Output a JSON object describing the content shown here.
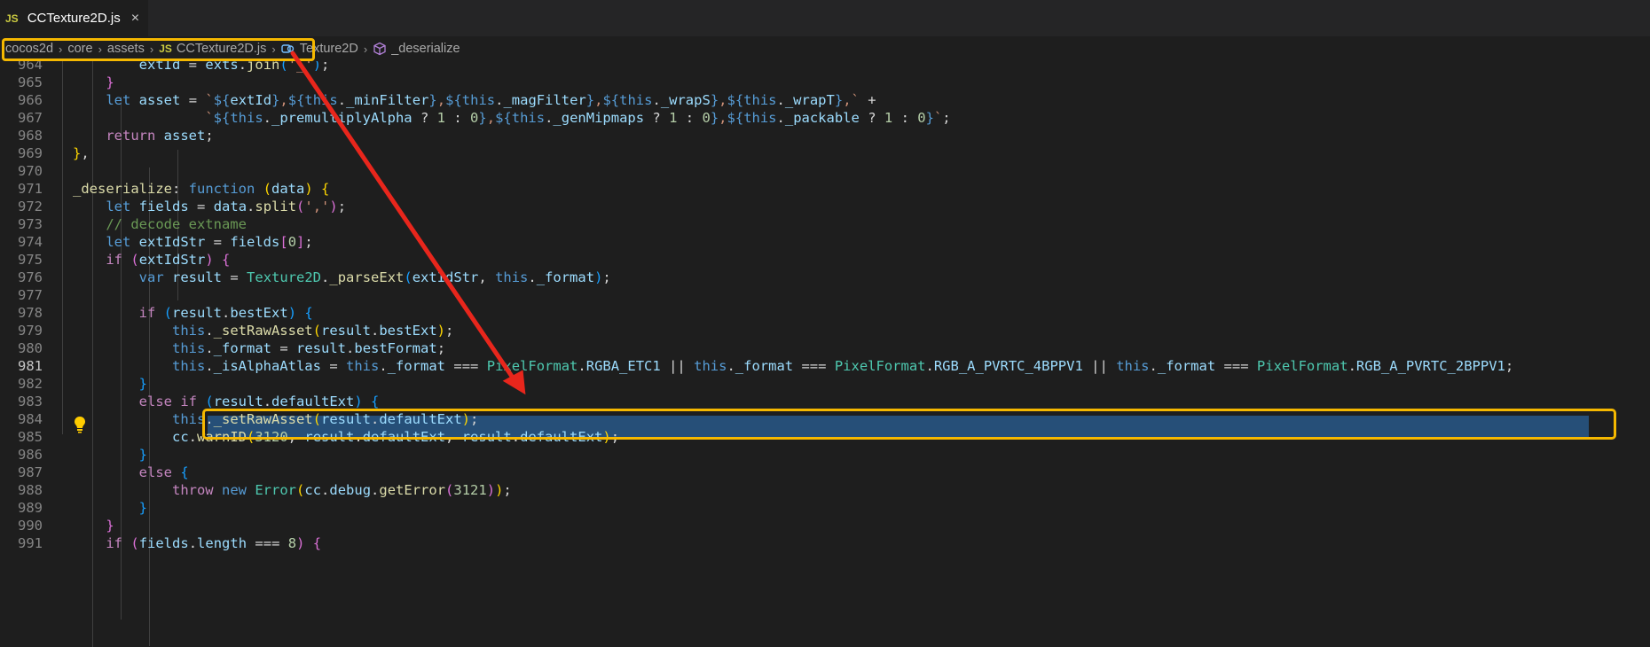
{
  "tab": {
    "badge": "JS",
    "filename": "CCTexture2D.js",
    "close": "×"
  },
  "breadcrumb": {
    "items": [
      "cocos2d",
      "core",
      "assets",
      "CCTexture2D.js",
      "Texture2D",
      "_deserialize"
    ],
    "file_badge": "JS",
    "separator": "›"
  },
  "editor": {
    "active_line": 981,
    "lines": [
      {
        "n": 964,
        "text": "            extId = exts.join('_');"
      },
      {
        "n": 965,
        "text": "        }"
      },
      {
        "n": 966,
        "text": "        let asset = `${extId},${this._minFilter},${this._magFilter},${this._wrapS},${this._wrapT},` +"
      },
      {
        "n": 967,
        "text": "                    `${this._premultiplyAlpha ? 1 : 0},${this._genMipmaps ? 1 : 0},${this._packable ? 1 : 0}`;"
      },
      {
        "n": 968,
        "text": "        return asset;"
      },
      {
        "n": 969,
        "text": "    },"
      },
      {
        "n": 970,
        "text": ""
      },
      {
        "n": 971,
        "text": "    _deserialize: function (data) {"
      },
      {
        "n": 972,
        "text": "        let fields = data.split(',');"
      },
      {
        "n": 973,
        "text": "        // decode extname"
      },
      {
        "n": 974,
        "text": "        let extIdStr = fields[0];"
      },
      {
        "n": 975,
        "text": "        if (extIdStr) {"
      },
      {
        "n": 976,
        "text": "            var result = Texture2D._parseExt(extIdStr, this._format);"
      },
      {
        "n": 977,
        "text": ""
      },
      {
        "n": 978,
        "text": "            if (result.bestExt) {"
      },
      {
        "n": 979,
        "text": "                this._setRawAsset(result.bestExt);"
      },
      {
        "n": 980,
        "text": "                this._format = result.bestFormat;"
      },
      {
        "n": 981,
        "text": "                this._isAlphaAtlas = this._format === PixelFormat.RGBA_ETC1 || this._format === PixelFormat.RGB_A_PVRTC_4BPPV1 || this._format === PixelFormat.RGB_A_PVRTC_2BPPV1;"
      },
      {
        "n": 982,
        "text": "            }"
      },
      {
        "n": 983,
        "text": "            else if (result.defaultExt) {"
      },
      {
        "n": 984,
        "text": "                this._setRawAsset(result.defaultExt);"
      },
      {
        "n": 985,
        "text": "                cc.warnID(3120, result.defaultExt, result.defaultExt);"
      },
      {
        "n": 986,
        "text": "            }"
      },
      {
        "n": 987,
        "text": "            else {"
      },
      {
        "n": 988,
        "text": "                throw new Error(cc.debug.getError(3121));"
      },
      {
        "n": 989,
        "text": "            }"
      },
      {
        "n": 990,
        "text": "        }"
      },
      {
        "n": 991,
        "text": "        if (fields.length === 8) {"
      }
    ]
  },
  "colors": {
    "background": "#1e1e1e",
    "highlight_box": "#f5b800",
    "arrow": "#e8261c",
    "selection": "#264f78"
  },
  "icons": [
    "js-file-icon",
    "class-icon",
    "method-cube-icon",
    "lightbulb-icon",
    "close-icon"
  ]
}
